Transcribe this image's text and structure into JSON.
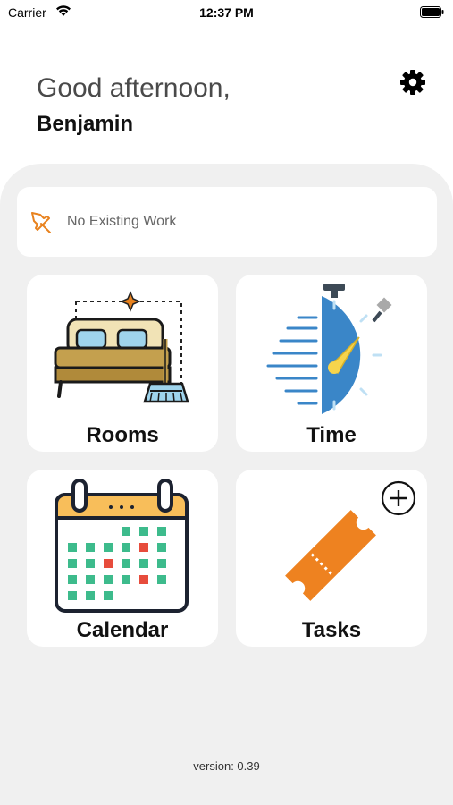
{
  "status_bar": {
    "carrier": "Carrier",
    "time": "12:37 PM"
  },
  "header": {
    "greeting": "Good afternoon,",
    "user_name": "Benjamin",
    "settings_icon": "gear-icon"
  },
  "work_banner": {
    "text": "No Existing Work",
    "icon": "pushpin-icon"
  },
  "tiles": [
    {
      "label": "Rooms",
      "icon": "bed-broom-icon"
    },
    {
      "label": "Time",
      "icon": "stopwatch-icon"
    },
    {
      "label": "Calendar",
      "icon": "calendar-icon"
    },
    {
      "label": "Tasks",
      "icon": "ticket-icon",
      "action_icon": "add-circle-icon"
    }
  ],
  "footer": {
    "version": "version: 0.39"
  },
  "colors": {
    "accent_orange": "#e8821e",
    "stopwatch_blue": "#3a86c8",
    "calendar_green": "#3dbb8c",
    "calendar_red": "#e74c3c",
    "calendar_header": "#f8be5a"
  }
}
